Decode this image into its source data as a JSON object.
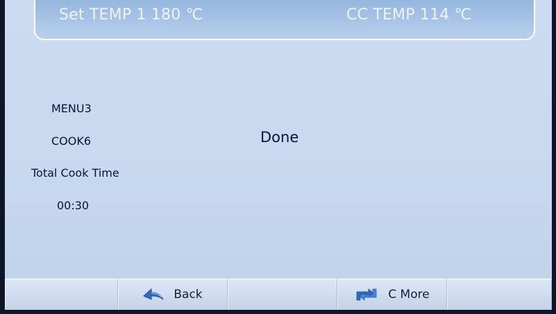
{
  "header": {
    "set_temp": "Set TEMP 1 180 ℃",
    "cc_temp": "CC TEMP 114 ℃"
  },
  "info": {
    "menu": "MENU3",
    "cook": "COOK6",
    "total_cook_time_label": "Total Cook Time",
    "total_cook_time_value": "00:30"
  },
  "status": "Done",
  "bottom_bar": {
    "back_label": "Back",
    "back_icon": "back-arrow-icon",
    "more_label": "C More",
    "more_icon": "cycle-arrows-icon"
  },
  "colors": {
    "screen_background": "#c9daf0",
    "header_panel": "#a9c4e6",
    "text_dark": "#0b1430",
    "icon_blue": "#2f6cc0"
  }
}
